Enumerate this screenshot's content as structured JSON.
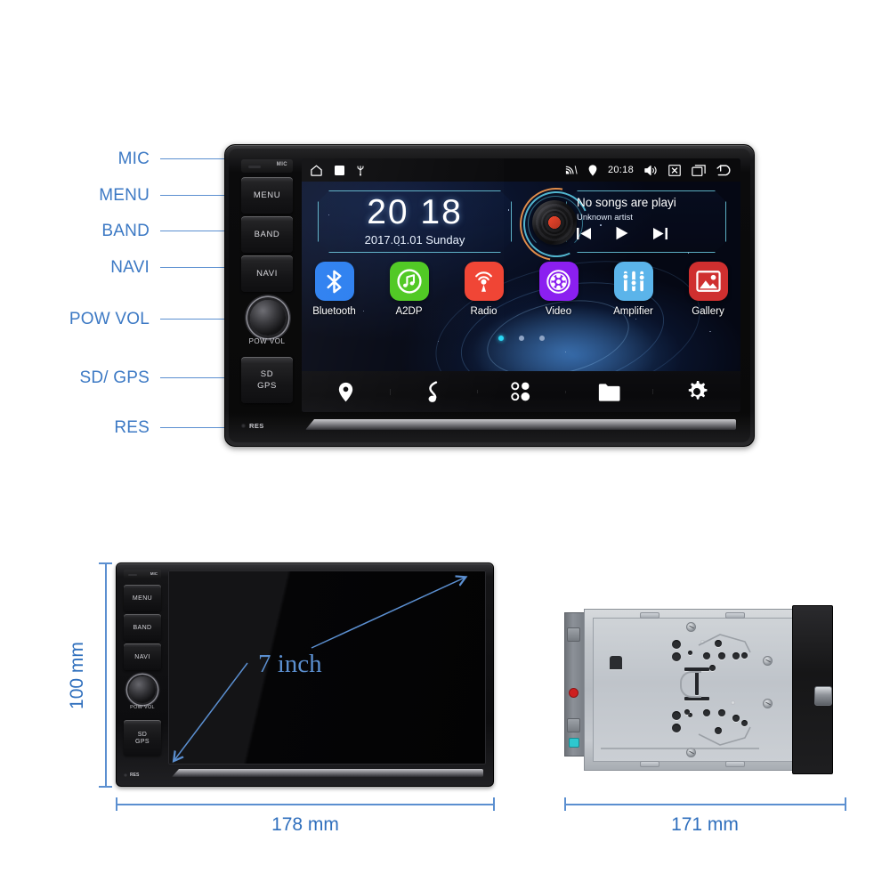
{
  "callouts": [
    {
      "label": "MIC"
    },
    {
      "label": "MENU"
    },
    {
      "label": "BAND"
    },
    {
      "label": "NAVI"
    },
    {
      "label": "POW VOL"
    },
    {
      "label": "SD/ GPS"
    },
    {
      "label": "RES"
    }
  ],
  "unit": {
    "side_buttons": [
      {
        "name": "mic",
        "label": "MIC"
      },
      {
        "name": "menu",
        "label": "MENU"
      },
      {
        "name": "band",
        "label": "BAND"
      },
      {
        "name": "navi",
        "label": "NAVI"
      }
    ],
    "knob_label": "POW  VOL",
    "sd_gps_label_line1": "SD",
    "sd_gps_label_line2": "GPS",
    "reset_label": "RES"
  },
  "statusbar": {
    "left_icons": [
      "home-icon",
      "stop-square-icon",
      "usb-icon"
    ],
    "right_icons": [
      "cast-icon",
      "location-icon",
      "volume-icon",
      "close-box-icon",
      "recents-icon",
      "back-icon"
    ],
    "time": "20:18"
  },
  "clock_widget": {
    "time": "20 18",
    "date": "2017.01.01 Sunday"
  },
  "music_widget": {
    "title": "No songs are playi",
    "artist": "Unknown artist",
    "controls": [
      "previous-track-icon",
      "play-icon",
      "next-track-icon"
    ],
    "album_art": "vinyl-record-icon"
  },
  "apps": [
    {
      "label": "Bluetooth",
      "icon": "bluetooth-icon",
      "color": "#2a7ef0"
    },
    {
      "label": "A2DP",
      "icon": "music-note-circle-icon",
      "color": "#4ec821"
    },
    {
      "label": "Radio",
      "icon": "radio-broadcast-icon",
      "color": "#f04434"
    },
    {
      "label": "Video",
      "icon": "film-reel-icon",
      "color": "#8b1ff0"
    },
    {
      "label": "Amplifier",
      "icon": "equalizer-sliders-icon",
      "color": "#5bb4ea"
    },
    {
      "label": "Gallery",
      "icon": "photo-image-icon",
      "color": "#cf2f2f"
    }
  ],
  "page_dots": {
    "count": 3,
    "active_index": 0,
    "active_color": "#29d7f5"
  },
  "dock": [
    {
      "name": "navigation",
      "icon": "location-pin-icon"
    },
    {
      "name": "music",
      "icon": "music-note-icon"
    },
    {
      "name": "apps",
      "icon": "apps-grid-icon"
    },
    {
      "name": "files",
      "icon": "folder-icon"
    },
    {
      "name": "settings",
      "icon": "gear-icon"
    }
  ],
  "dimensions": {
    "screen_size": "7 inch",
    "height": "100 mm",
    "width": "178 mm",
    "depth": "171 mm"
  },
  "colors": {
    "callout_blue": "#3c79c4",
    "dimension_blue": "#2f6fbd",
    "screen_accent_cyan": "#6ccde2"
  }
}
